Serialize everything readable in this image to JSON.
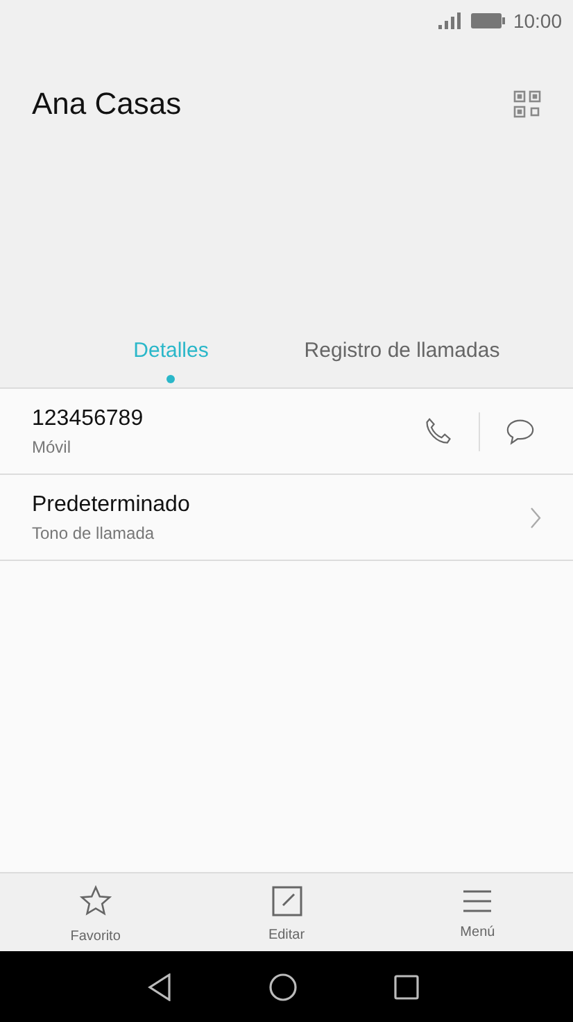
{
  "status_bar": {
    "time": "10:00"
  },
  "contact": {
    "name": "Ana Casas"
  },
  "tabs": [
    {
      "label": "Detalles",
      "selected": true
    },
    {
      "label": "Registro de llamadas",
      "selected": false
    }
  ],
  "rows": [
    {
      "kind": "phone",
      "title": "123456789",
      "subtitle": "Móvil"
    },
    {
      "kind": "setting",
      "title": "Predeterminado",
      "subtitle": "Tono de llamada"
    }
  ],
  "bottom_actions": [
    {
      "kind": "favorite",
      "label": "Favorito"
    },
    {
      "kind": "edit",
      "label": "Editar"
    },
    {
      "kind": "menu",
      "label": "Menú"
    }
  ]
}
